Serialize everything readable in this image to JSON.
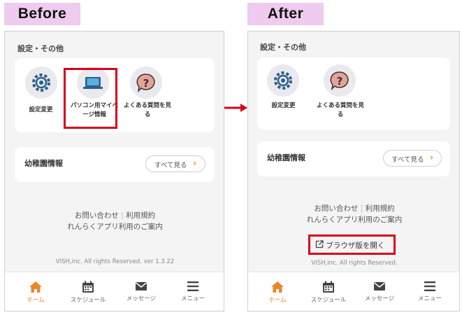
{
  "labels": {
    "before": "Before",
    "after": "After"
  },
  "before": {
    "section_title": "設定・その他",
    "items": [
      {
        "label": "設定変更",
        "icon": "gear-icon"
      },
      {
        "label": "パソコン用マイページ情報",
        "icon": "laptop-icon"
      },
      {
        "label": "よくある質問を見る",
        "icon": "question-icon"
      }
    ],
    "info_title": "幼稚園情報",
    "see_all": "すべて見る",
    "links": {
      "contact": "お問い合わせ",
      "terms": "利用規約",
      "guide": "れんらくアプリ利用のご案内"
    },
    "copyright": "VISH,inc. All rights Reserved. ver 1.3.22"
  },
  "after": {
    "section_title": "設定・その他",
    "items": [
      {
        "label": "設定変更",
        "icon": "gear-icon"
      },
      {
        "label": "よくある質問を見る",
        "icon": "question-icon"
      }
    ],
    "info_title": "幼稚園情報",
    "see_all": "すべて見る",
    "links": {
      "contact": "お問い合わせ",
      "terms": "利用規約",
      "guide": "れんらくアプリ利用のご案内"
    },
    "browser_button": "ブラウザ版を開く",
    "copyright": "VISH,inc. All rights Reserved."
  },
  "nav": [
    {
      "label": "ホーム",
      "icon": "home-icon",
      "active": true
    },
    {
      "label": "スケジュール",
      "icon": "calendar-icon",
      "active": false
    },
    {
      "label": "メッセージ",
      "icon": "mail-icon",
      "active": false
    },
    {
      "label": "メニュー",
      "icon": "menu-icon",
      "active": false
    }
  ],
  "colors": {
    "highlight": "#d9001b",
    "accent": "#e8882a",
    "tag_bg": "#eecbef",
    "arrow": "#d9001b"
  }
}
